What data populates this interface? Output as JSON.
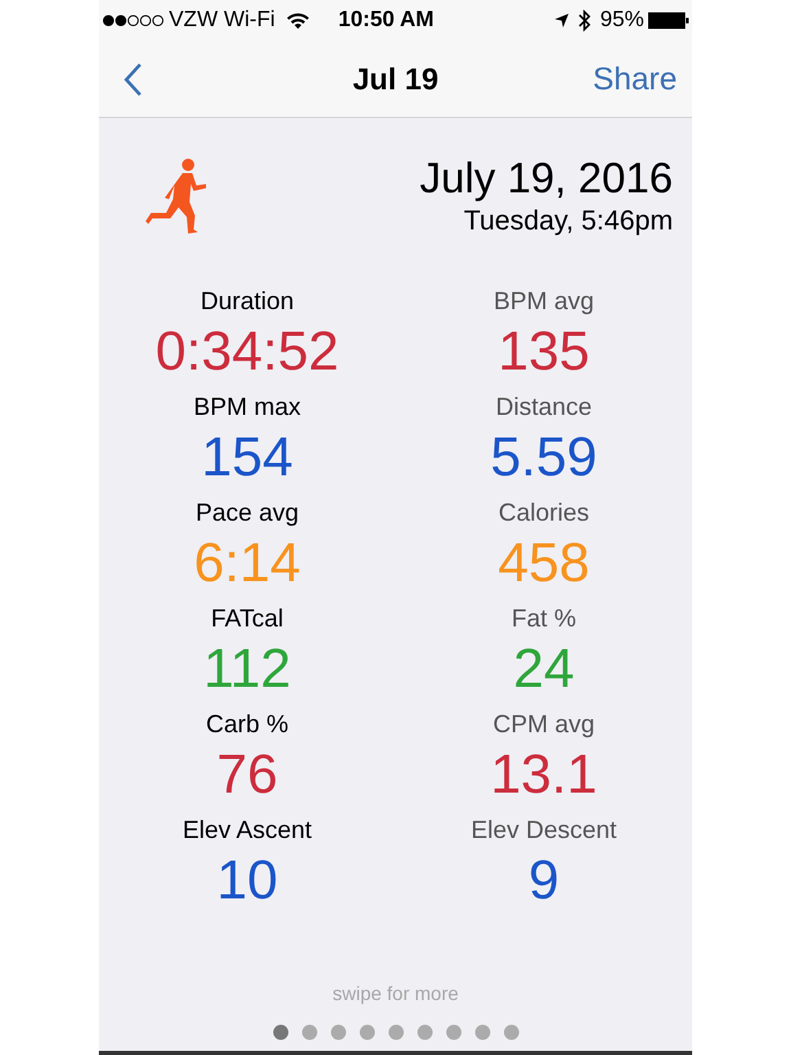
{
  "status_bar": {
    "carrier": "VZW Wi-Fi",
    "time": "10:50 AM",
    "battery": "95%"
  },
  "nav": {
    "title": "Jul 19",
    "action": "Share"
  },
  "workout": {
    "date": "July 19, 2016",
    "subtitle": "Tuesday, 5:46pm"
  },
  "metrics": [
    {
      "label": "Duration",
      "value": "0:34:52",
      "color": "#cc2d3d"
    },
    {
      "label": "BPM avg",
      "value": "135",
      "color": "#cc2d3d"
    },
    {
      "label": "BPM max",
      "value": "154",
      "color": "#1b55c9"
    },
    {
      "label": "Distance",
      "value": "5.59",
      "color": "#1b55c9"
    },
    {
      "label": "Pace avg",
      "value": "6:14",
      "color": "#f7931e"
    },
    {
      "label": "Calories",
      "value": "458",
      "color": "#f7931e"
    },
    {
      "label": "FATcal",
      "value": "112",
      "color": "#2ea63b"
    },
    {
      "label": "Fat %",
      "value": "24",
      "color": "#2ea63b"
    },
    {
      "label": "Carb %",
      "value": "76",
      "color": "#cc2d3d"
    },
    {
      "label": "CPM avg",
      "value": "13.1",
      "color": "#cc2d3d"
    },
    {
      "label": "Elev Ascent",
      "value": "10",
      "color": "#1b55c9"
    },
    {
      "label": "Elev Descent",
      "value": "9",
      "color": "#1b55c9"
    }
  ],
  "hint": "swipe for more",
  "pages": [
    {
      "selected": true
    },
    {
      "selected": false
    },
    {
      "selected": false
    },
    {
      "selected": false
    },
    {
      "selected": false
    },
    {
      "selected": false
    },
    {
      "selected": false
    },
    {
      "selected": false
    },
    {
      "selected": false
    }
  ]
}
